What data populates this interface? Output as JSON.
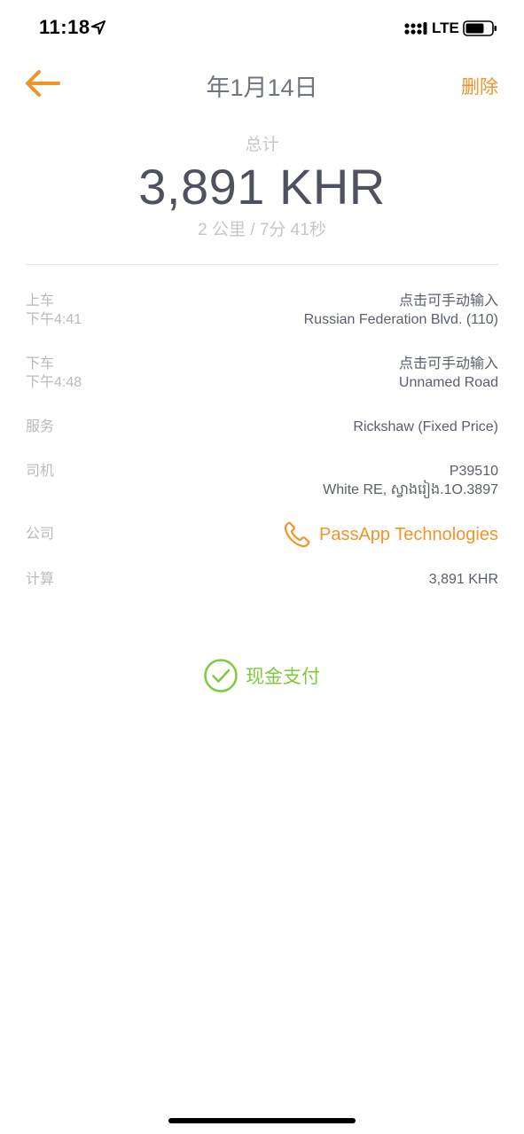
{
  "status_bar": {
    "time": "11:18",
    "network": "LTE"
  },
  "nav": {
    "title": "年1月14日",
    "delete_label": "删除",
    "back_icon": "arrow-left-icon"
  },
  "summary": {
    "total_label": "总计",
    "total_amount": "3,891 KHR",
    "distance_duration": "2 公里 / 7分 41秒"
  },
  "details": {
    "pickup": {
      "label": "上车",
      "time": "下午4:41",
      "hint": "点击可手动输入",
      "address": "Russian Federation Blvd. (110)"
    },
    "dropoff": {
      "label": "下车",
      "time": "下午4:48",
      "hint": "点击可手动输入",
      "address": "Unnamed Road"
    },
    "service": {
      "label": "服务",
      "value": "Rickshaw (Fixed Price)"
    },
    "driver": {
      "label": "司机",
      "id": "P39510",
      "vehicle": "White RE, ស្វាងរៀង.1O.3897"
    },
    "company": {
      "label": "公司",
      "name": "PassApp Technologies",
      "icon": "phone-icon"
    },
    "calculation": {
      "label": "计算",
      "value": "3,891 KHR"
    }
  },
  "payment": {
    "method": "现金支付",
    "icon": "check-circle-icon"
  },
  "colors": {
    "accent": "#f0952a",
    "success": "#7dca3c",
    "text": "#4e5260",
    "muted": "#b7bac1"
  }
}
